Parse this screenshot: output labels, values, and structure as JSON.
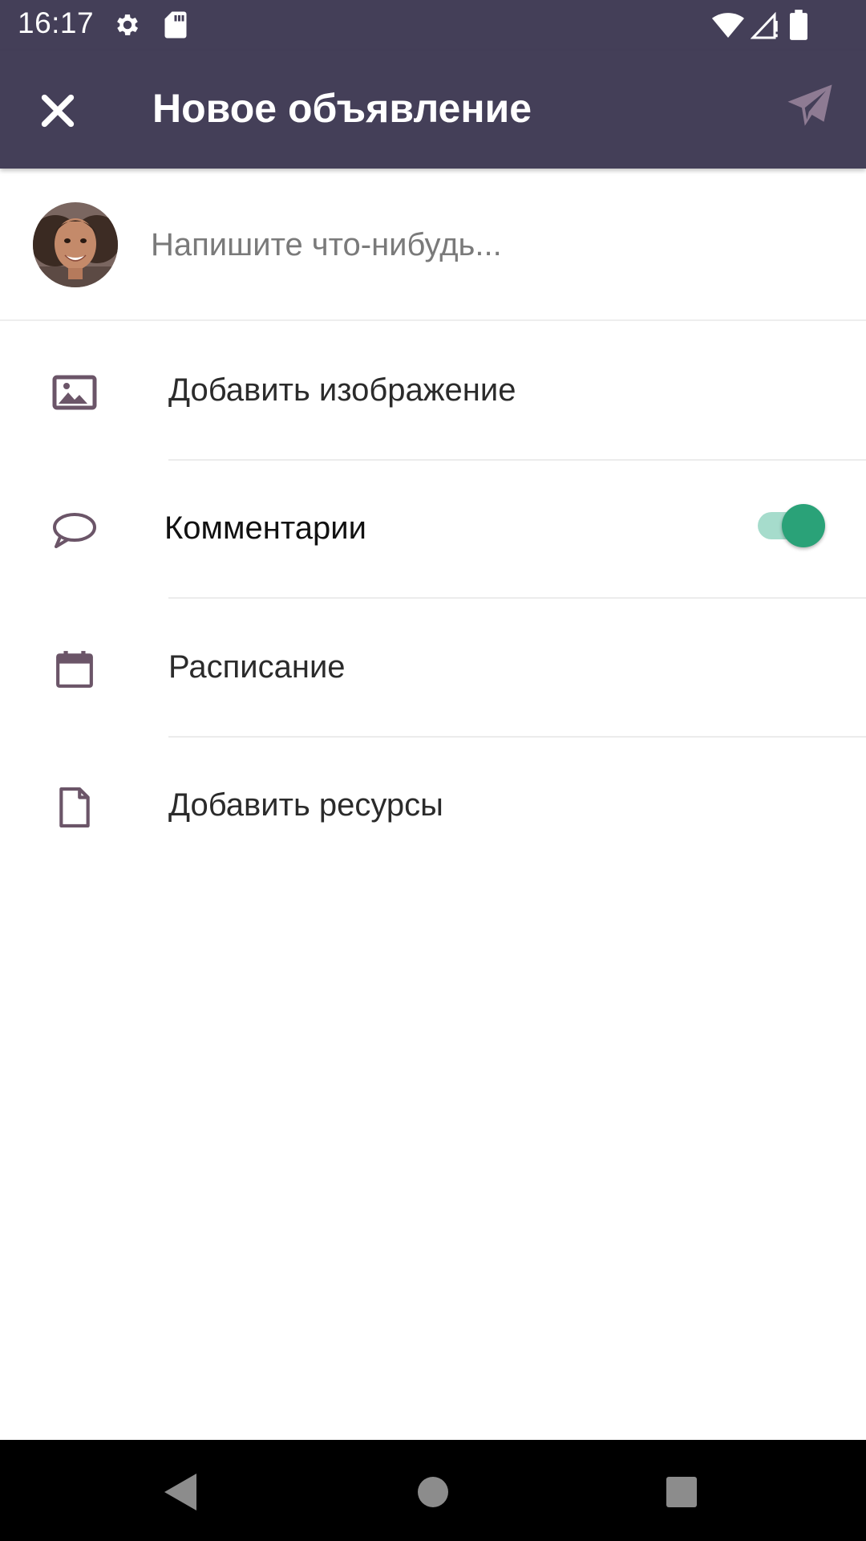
{
  "status_bar": {
    "time": "16:17",
    "icons": [
      "gear-icon",
      "sd-card-icon",
      "wifi-icon",
      "signal-icon",
      "battery-icon"
    ],
    "background": "#443f58"
  },
  "app_bar": {
    "title": "Новое объявление",
    "close_icon": "close-icon",
    "send_icon": "send-icon",
    "background": "#443f58"
  },
  "compose": {
    "placeholder": "Напишите что-нибудь...",
    "value": ""
  },
  "options": [
    {
      "label": "Добавить изображение",
      "icon": "image-icon"
    },
    {
      "label": "Комментарии",
      "icon": "comment-icon",
      "toggle_on": true
    },
    {
      "label": "Расписание",
      "icon": "calendar-icon"
    },
    {
      "label": "Добавить ресурсы",
      "icon": "document-icon"
    }
  ],
  "colors": {
    "accent": "#2aa278",
    "icon": "#6b5568",
    "send_disabled": "#8e7b93"
  },
  "nav_bar": {
    "buttons": [
      "back-icon",
      "home-icon",
      "recents-icon"
    ]
  }
}
